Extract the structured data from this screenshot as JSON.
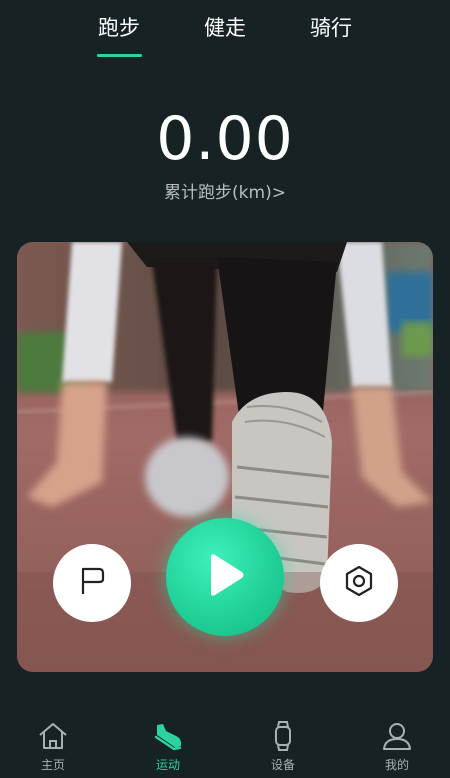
{
  "tabs": [
    {
      "label": "跑步",
      "active": true
    },
    {
      "label": "健走",
      "active": false
    },
    {
      "label": "骑行",
      "active": false
    }
  ],
  "stats": {
    "distance": "0.00",
    "distance_label": "累计跑步(km)>"
  },
  "controls": {
    "flag_icon": "flag-icon",
    "play_icon": "play-icon",
    "settings_icon": "hexagon-settings-icon"
  },
  "bottom_nav": [
    {
      "label": "主页",
      "icon": "home-icon",
      "active": false
    },
    {
      "label": "运动",
      "icon": "shoe-icon",
      "active": true
    },
    {
      "label": "设备",
      "icon": "watch-icon",
      "active": false
    },
    {
      "label": "我的",
      "icon": "user-icon",
      "active": false
    }
  ],
  "colors": {
    "background": "#172224",
    "accent": "#2ad3a0",
    "inactive_text": "#a9b0b1"
  }
}
